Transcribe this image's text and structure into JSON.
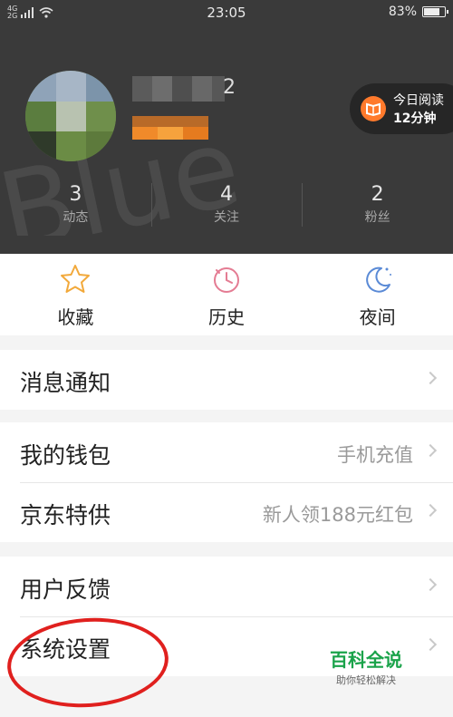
{
  "status_bar": {
    "network_1": "4G",
    "network_2": "2G",
    "time": "23:05",
    "battery": "83%",
    "battery_level": 0.83
  },
  "profile": {
    "username_hidden": "2",
    "reading_today": {
      "title": "今日阅读",
      "duration": "12分钟"
    },
    "stats": [
      {
        "value": "3",
        "label": "动态"
      },
      {
        "value": "4",
        "label": "关注"
      },
      {
        "value": "2",
        "label": "粉丝"
      }
    ]
  },
  "quick_actions": [
    {
      "label": "收藏",
      "icon": "star-icon"
    },
    {
      "label": "历史",
      "icon": "clock-icon"
    },
    {
      "label": "夜间",
      "icon": "moon-icon"
    }
  ],
  "menu_groups": [
    [
      {
        "label": "消息通知",
        "value": ""
      }
    ],
    [
      {
        "label": "我的钱包",
        "value": "手机充值"
      },
      {
        "label": "京东特供",
        "value": "新人领188元红包"
      }
    ],
    [
      {
        "label": "用户反馈",
        "value": ""
      },
      {
        "label": "系统设置",
        "value": ""
      }
    ]
  ],
  "watermark": {
    "title": "百科全说",
    "subtitle": "助你轻松解决"
  },
  "colors": {
    "accent_orange": "#ff7a2c",
    "header_bg": "#3a3a3a",
    "annotation_red": "#e0201e",
    "watermark_green": "#1aa34a"
  }
}
